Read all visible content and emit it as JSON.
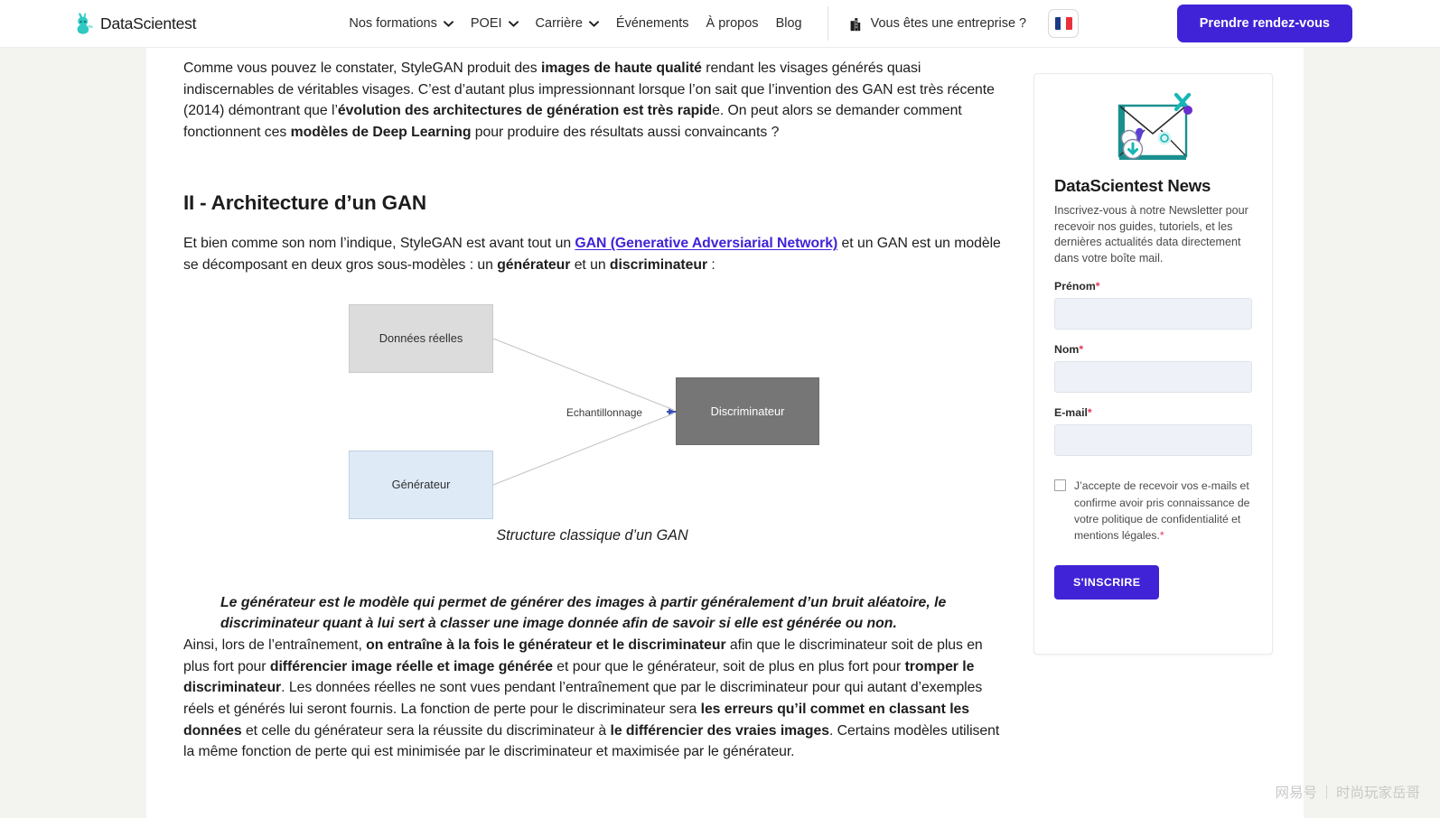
{
  "header": {
    "logo_text": "DataScientest",
    "logo_icon": "datascientest-rabbit-logo-icon",
    "nav": [
      {
        "label": "Nos formations",
        "has_caret": true
      },
      {
        "label": "POEI",
        "has_caret": true
      },
      {
        "label": "Carrière",
        "has_caret": true
      },
      {
        "label": "Événements",
        "has_caret": false
      },
      {
        "label": "À propos",
        "has_caret": false
      },
      {
        "label": "Blog",
        "has_caret": false
      }
    ],
    "enterprise_label": "Vous êtes une entreprise ?",
    "enterprise_icon": "building-icon",
    "language": "FR",
    "language_icon": "french-flag-icon",
    "cta_label": "Prendre rendez-vous",
    "accent_color": "#4023d6"
  },
  "article": {
    "p1_parts": [
      {
        "t": "Comme vous pouvez le constater, StyleGAN produit des ",
        "b": false
      },
      {
        "t": "images de haute qualité",
        "b": true
      },
      {
        "t": " rendant les visages générés quasi indiscernables de véritables visages. C’est d’autant plus impressionnant lorsque l’on sait que l’invention des GAN est très récente (2014) démontrant que l’",
        "b": false
      },
      {
        "t": "évolution des architectures de génération est très rapid",
        "b": true
      },
      {
        "t": "e. On peut alors se demander comment fonctionnent ces ",
        "b": false
      },
      {
        "t": "modèles de Deep Learning",
        "b": true
      },
      {
        "t": " pour produire des résultats aussi convaincants ?",
        "b": false
      }
    ],
    "heading": "II - Architecture d’un GAN",
    "p2_parts": [
      {
        "t": "Et bien comme son nom l’indique, StyleGAN est avant tout un ",
        "b": false
      },
      {
        "t": "GAN (Generative Adversiarial Network)",
        "b": false,
        "link": true
      },
      {
        "t": " et un GAN est un modèle se décomposant en deux gros sous-modèles : un ",
        "b": false
      },
      {
        "t": "générateur",
        "b": true
      },
      {
        "t": " et un ",
        "b": false
      },
      {
        "t": "discriminateur",
        "b": true
      },
      {
        "t": " :",
        "b": false
      }
    ],
    "figure": {
      "caption": "Structure classique d’un GAN",
      "nodes": [
        {
          "id": "real",
          "label": "Données réelles",
          "fill": "#dcdcdc"
        },
        {
          "id": "gen",
          "label": "Générateur",
          "fill": "#dfeaf7"
        },
        {
          "id": "disc",
          "label": "Discriminateur",
          "fill": "#767676"
        }
      ],
      "edge_label": "Echantillonnage"
    },
    "quote": "Le générateur est le modèle qui permet de générer des images à partir généralement d’un bruit aléatoire, le discriminateur quant à lui sert à classer une image donnée afin de savoir si elle est générée ou non.",
    "p3_parts": [
      {
        "t": "Ainsi, lors de l’entraînement, ",
        "b": false
      },
      {
        "t": "on entraîne à la fois le générateur et le discriminateur",
        "b": true
      },
      {
        "t": " afin que le discriminateur soit de plus en plus fort pour ",
        "b": false
      },
      {
        "t": "différencier image réelle et image générée",
        "b": true
      },
      {
        "t": " et pour que le générateur, soit de plus en plus fort pour ",
        "b": false
      },
      {
        "t": "tromper le discriminateur",
        "b": true
      },
      {
        "t": ". Les données réelles ne sont vues pendant l’entraînement que par le discriminateur pour qui autant d’exemples réels et générés lui seront fournis. La fonction de perte pour le discriminateur sera ",
        "b": false
      },
      {
        "t": "les erreurs qu’il commet en classant les données",
        "b": true
      },
      {
        "t": " et celle du générateur sera la réussite du discriminateur à ",
        "b": false
      },
      {
        "t": "le différencier des vraies images",
        "b": true
      },
      {
        "t": ". Certains modèles utilisent la même fonction de perte qui est minimisée par le discriminateur et maximisée par le générateur.",
        "b": false
      }
    ]
  },
  "sidebar": {
    "icon": "newsletter-envelope-icon",
    "title": "DataScientest News",
    "description": "Inscrivez-vous à notre Newsletter pour recevoir nos guides, tutoriels, et les dernières actualités data directement dans votre boîte mail.",
    "fields": [
      {
        "label": "Prénom",
        "required": true,
        "value": "",
        "placeholder": ""
      },
      {
        "label": "Nom",
        "required": true,
        "value": "",
        "placeholder": ""
      },
      {
        "label": "E-mail",
        "required": true,
        "value": "",
        "placeholder": ""
      }
    ],
    "consent_text": "J’accepte de recevoir vos e-mails et confirme avoir pris connaissance de votre politique de confidentialité et mentions légales.",
    "consent_required": true,
    "consent_checked": false,
    "submit_label": "S'INSCRIRE"
  },
  "watermark": {
    "brand": "网易号",
    "author": "时尚玩家岳哥"
  }
}
